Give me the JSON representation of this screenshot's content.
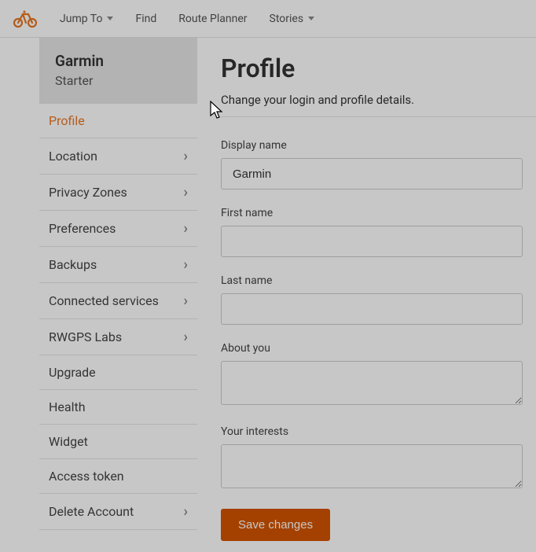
{
  "nav": {
    "items": [
      {
        "label": "Jump To",
        "dropdown": true
      },
      {
        "label": "Find",
        "dropdown": false
      },
      {
        "label": "Route Planner",
        "dropdown": false
      },
      {
        "label": "Stories",
        "dropdown": true
      }
    ]
  },
  "user": {
    "name": "Garmin",
    "plan": "Starter"
  },
  "sidebar": {
    "items": [
      {
        "label": "Profile",
        "chevron": false,
        "active": true
      },
      {
        "label": "Location",
        "chevron": true,
        "active": false
      },
      {
        "label": "Privacy Zones",
        "chevron": true,
        "active": false
      },
      {
        "label": "Preferences",
        "chevron": true,
        "active": false
      },
      {
        "label": "Backups",
        "chevron": true,
        "active": false
      },
      {
        "label": "Connected services",
        "chevron": true,
        "active": false
      },
      {
        "label": "RWGPS Labs",
        "chevron": true,
        "active": false
      },
      {
        "label": "Upgrade",
        "chevron": false,
        "active": false
      },
      {
        "label": "Health",
        "chevron": false,
        "active": false
      },
      {
        "label": "Widget",
        "chevron": false,
        "active": false
      },
      {
        "label": "Access token",
        "chevron": false,
        "active": false
      },
      {
        "label": "Delete Account",
        "chevron": true,
        "active": false
      }
    ]
  },
  "page": {
    "title": "Profile",
    "subtitle": "Change your login and profile details."
  },
  "form": {
    "display_name_label": "Display name",
    "display_name_value": "Garmin",
    "first_name_label": "First name",
    "first_name_value": "",
    "last_name_label": "Last name",
    "last_name_value": "",
    "about_you_label": "About you",
    "about_you_value": "",
    "interests_label": "Your interests",
    "interests_value": "",
    "save_label": "Save changes"
  }
}
